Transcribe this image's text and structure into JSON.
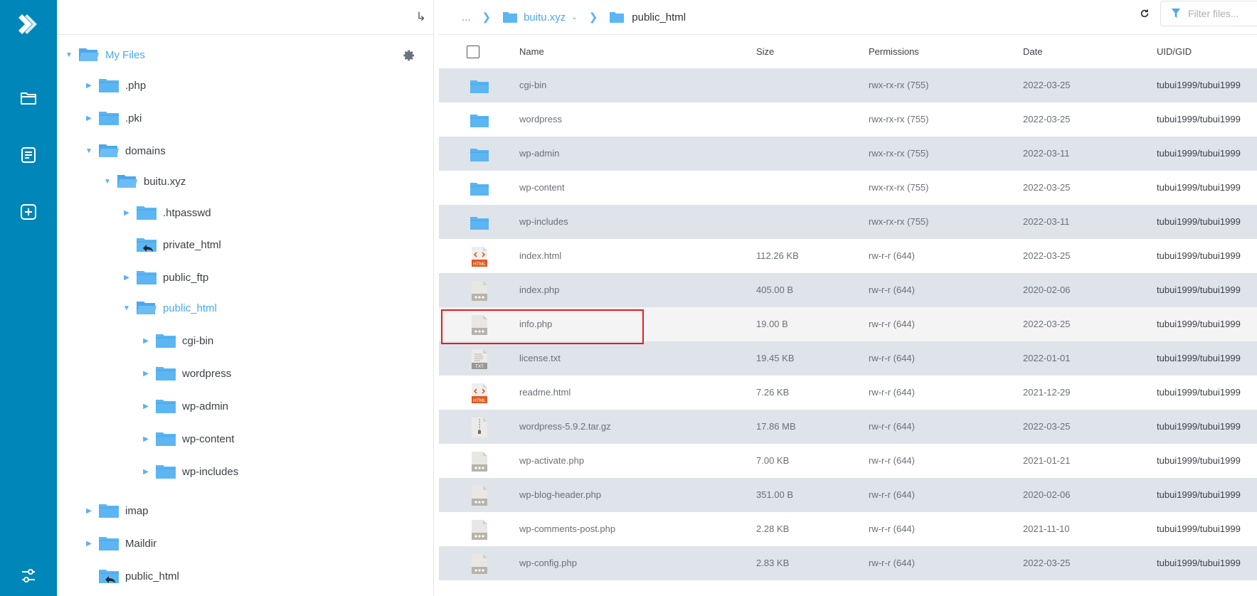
{
  "rail": {
    "items": [
      {
        "name": "logo-icon"
      },
      {
        "name": "folder-icon"
      },
      {
        "name": "document-icon"
      },
      {
        "name": "add-icon"
      },
      {
        "name": "settings-sliders-icon"
      }
    ],
    "color": "#0086b8"
  },
  "tree": {
    "collapse_icon": "↳",
    "root_label": "My Files",
    "items": [
      {
        "label": ".php",
        "level": 1,
        "toggle": "closed"
      },
      {
        "label": ".pki",
        "level": 1,
        "toggle": "closed"
      },
      {
        "label": "domains",
        "level": 1,
        "toggle": "open"
      },
      {
        "label": "buitu.xyz",
        "level": 2,
        "toggle": "open"
      },
      {
        "label": ".htpasswd",
        "level": 3,
        "toggle": "closed"
      },
      {
        "label": "private_html",
        "level": 3,
        "toggle": "none",
        "link": true
      },
      {
        "label": "public_ftp",
        "level": 3,
        "toggle": "closed"
      },
      {
        "label": "public_html",
        "level": 3,
        "toggle": "open",
        "active": true
      },
      {
        "label": "cgi-bin",
        "level": 4,
        "toggle": "closed"
      },
      {
        "label": "wordpress",
        "level": 4,
        "toggle": "closed"
      },
      {
        "label": "wp-admin",
        "level": 4,
        "toggle": "closed"
      },
      {
        "label": "wp-content",
        "level": 4,
        "toggle": "closed"
      },
      {
        "label": "wp-includes",
        "level": 4,
        "toggle": "closed"
      },
      {
        "label": "imap",
        "level": 1,
        "toggle": "closed"
      },
      {
        "label": "Maildir",
        "level": 1,
        "toggle": "closed"
      },
      {
        "label": "public_html",
        "level": 1,
        "toggle": "none",
        "link": true
      }
    ]
  },
  "breadcrumb": {
    "ellipsis": "...",
    "parent": "buitu.xyz",
    "current": "public_html"
  },
  "filter": {
    "placeholder": "Filter files..."
  },
  "table": {
    "headers": {
      "name": "Name",
      "size": "Size",
      "permissions": "Permissions",
      "date": "Date",
      "uid": "UID/GID"
    },
    "rows": [
      {
        "icon": "folder",
        "name": "cgi-bin",
        "size": "",
        "perm": "rwx-rx-rx (755)",
        "date": "2022-03-25",
        "uid": "tubui1999/tubui1999"
      },
      {
        "icon": "folder",
        "name": "wordpress",
        "size": "",
        "perm": "rwx-rx-rx (755)",
        "date": "2022-03-25",
        "uid": "tubui1999/tubui1999"
      },
      {
        "icon": "folder",
        "name": "wp-admin",
        "size": "",
        "perm": "rwx-rx-rx (755)",
        "date": "2022-03-11",
        "uid": "tubui1999/tubui1999"
      },
      {
        "icon": "folder",
        "name": "wp-content",
        "size": "",
        "perm": "rwx-rx-rx (755)",
        "date": "2022-03-25",
        "uid": "tubui1999/tubui1999"
      },
      {
        "icon": "folder",
        "name": "wp-includes",
        "size": "",
        "perm": "rwx-rx-rx (755)",
        "date": "2022-03-11",
        "uid": "tubui1999/tubui1999"
      },
      {
        "icon": "html",
        "name": "index.html",
        "size": "112.26 KB",
        "perm": "rw-r-r (644)",
        "date": "2022-03-25",
        "uid": "tubui1999/tubui1999"
      },
      {
        "icon": "php",
        "name": "index.php",
        "size": "405.00 B",
        "perm": "rw-r-r (644)",
        "date": "2020-02-06",
        "uid": "tubui1999/tubui1999"
      },
      {
        "icon": "php",
        "name": "info.php",
        "size": "19.00 B",
        "perm": "rw-r-r (644)",
        "date": "2022-03-25",
        "uid": "tubui1999/tubui1999",
        "selected": true
      },
      {
        "icon": "txt",
        "name": "license.txt",
        "size": "19.45 KB",
        "perm": "rw-r-r (644)",
        "date": "2022-01-01",
        "uid": "tubui1999/tubui1999"
      },
      {
        "icon": "html",
        "name": "readme.html",
        "size": "7.26 KB",
        "perm": "rw-r-r (644)",
        "date": "2021-12-29",
        "uid": "tubui1999/tubui1999"
      },
      {
        "icon": "zip",
        "name": "wordpress-5.9.2.tar.gz",
        "size": "17.86 MB",
        "perm": "rw-r-r (644)",
        "date": "2022-03-25",
        "uid": "tubui1999/tubui1999"
      },
      {
        "icon": "php",
        "name": "wp-activate.php",
        "size": "7.00 KB",
        "perm": "rw-r-r (644)",
        "date": "2021-01-21",
        "uid": "tubui1999/tubui1999"
      },
      {
        "icon": "php",
        "name": "wp-blog-header.php",
        "size": "351.00 B",
        "perm": "rw-r-r (644)",
        "date": "2020-02-06",
        "uid": "tubui1999/tubui1999"
      },
      {
        "icon": "php",
        "name": "wp-comments-post.php",
        "size": "2.28 KB",
        "perm": "rw-r-r (644)",
        "date": "2021-11-10",
        "uid": "tubui1999/tubui1999"
      },
      {
        "icon": "php",
        "name": "wp-config.php",
        "size": "2.83 KB",
        "perm": "rw-r-r (644)",
        "date": "2022-03-25",
        "uid": "tubui1999/tubui1999"
      }
    ]
  },
  "colors": {
    "accent": "#4aa8ec",
    "folder": "#5bb6f2",
    "highlight": "#e0201e",
    "alt_row": "#dfe3ea"
  }
}
